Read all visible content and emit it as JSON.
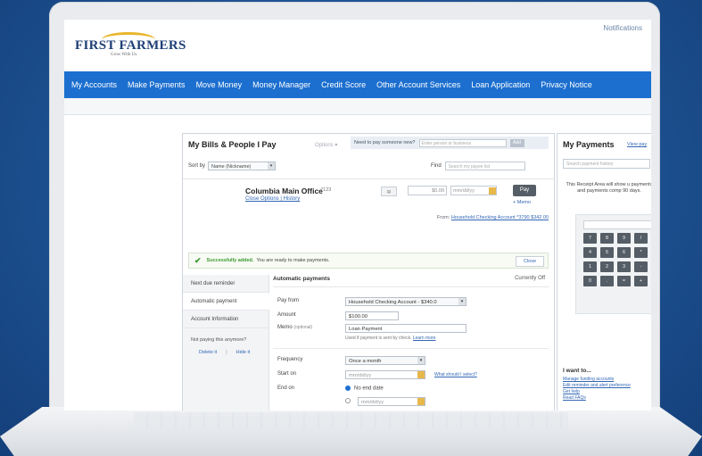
{
  "brand": {
    "name": "FIRST FARMERS",
    "tagline": "Grow With Us."
  },
  "header": {
    "notifications": "Notifications"
  },
  "nav": {
    "items": [
      "My Accounts",
      "Make Payments",
      "Move Money",
      "Money Manager",
      "Credit Score",
      "Other Account Services",
      "Loan Application",
      "Privacy Notice"
    ]
  },
  "bills": {
    "title": "My Bills & People I Pay",
    "options": "Options ▾",
    "question": "Need to pay someone new?",
    "question_placeholder": "Enter person or business",
    "add_label": "Add",
    "sort_label": "Sort by",
    "sort_value": "Name (Nickname)",
    "find_label": "Find",
    "find_placeholder": "Search my payee list",
    "payee": {
      "name": "Columbia Main Office",
      "acct": "*123",
      "links": "Close Options | History",
      "amount": "$0.00",
      "date_placeholder": "mm/dd/yy",
      "pay_label": "Pay",
      "memo_link": "+ Memo",
      "from_prefix": "From:",
      "from_account": "Household Checking Account *3790 $342.00"
    },
    "success": {
      "strong": "Successfully added.",
      "text": "You are ready to make payments.",
      "close": "Close"
    },
    "tabs": [
      "Next due reminder",
      "Automatic payment",
      "Account Information"
    ],
    "not_paying": "Not paying this anymore?",
    "not_paying_links": [
      "Delete it",
      "Hide it"
    ],
    "auto": {
      "title": "Automatic payments",
      "status": "Currently Off",
      "pay_from_label": "Pay from",
      "pay_from_value": "Household Checking Account - $340.0",
      "amount_label": "Amount",
      "amount_value": "$100.00",
      "memo_label": "Memo",
      "memo_optional": "(optional)",
      "memo_value": "Loan Payment",
      "memo_hint": "Used if payment is sent by check.",
      "memo_hint_link": "Learn more",
      "frequency_label": "Frequency",
      "frequency_value": "Once a month",
      "start_label": "Start on",
      "start_placeholder": "mm/dd/yy",
      "start_link": "What should I select?",
      "end_label": "End on",
      "end_option": "No end date",
      "end_placeholder": "mm/dd/yy"
    }
  },
  "payments": {
    "title": "My Payments",
    "view": "View pay",
    "search_placeholder": "Search payment history",
    "receipt": "This Receipt Area will show u payments and payments comp 90 days.",
    "keys": [
      "7",
      "8",
      "9",
      "/",
      "4",
      "5",
      "6",
      "*",
      "1",
      "2",
      "3",
      "-",
      "0",
      ".",
      "=",
      "+"
    ],
    "iwant_title": "I want to...",
    "iwant_links": [
      "Manage funding accounts",
      "Edit reminder and alert preference",
      "Get help",
      "Read FAQs"
    ]
  }
}
